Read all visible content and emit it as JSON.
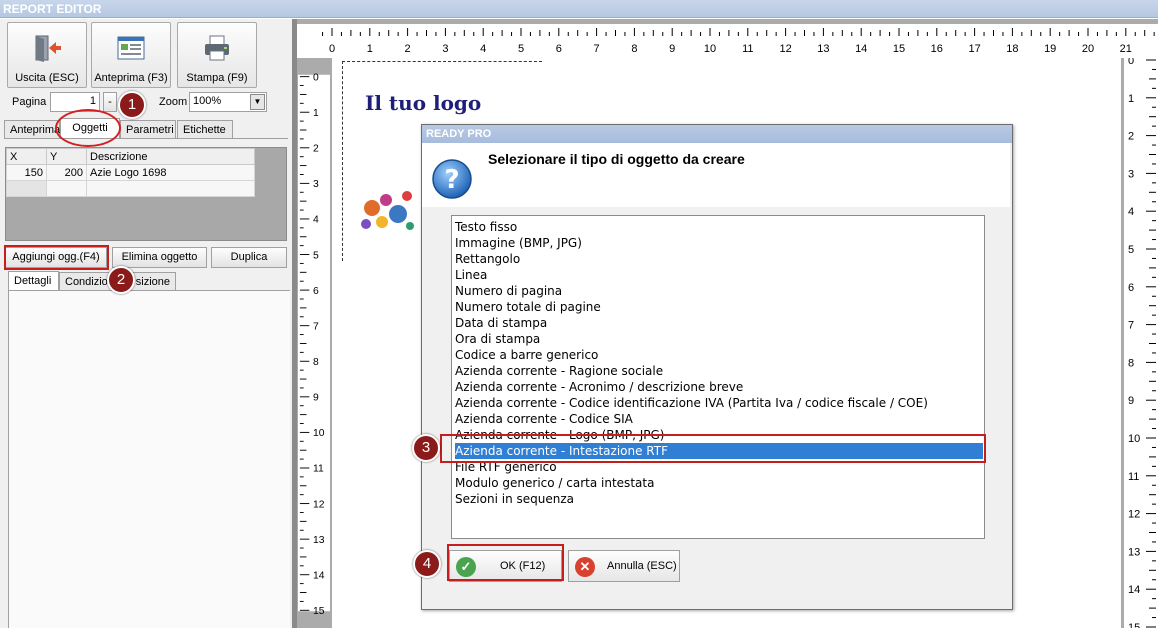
{
  "window": {
    "title": "REPORT EDITOR"
  },
  "toolbar": {
    "exit_label": "Uscita (ESC)",
    "preview_label": "Anteprima (F3)",
    "print_label": "Stampa (F9)"
  },
  "pager": {
    "page_label": "Pagina",
    "page_value": "1",
    "minus_label": "-",
    "zoom_label": "Zoom",
    "zoom_value": "100%"
  },
  "tabs": [
    "Anteprima",
    "Oggetti",
    "Parametri",
    "Etichette"
  ],
  "objects_table": {
    "columns": [
      "X",
      "Y",
      "Descrizione"
    ],
    "rows": [
      {
        "x": "150",
        "y": "200",
        "descrizione": "Azie Logo 1698"
      }
    ]
  },
  "actions": {
    "add_label": "Aggiungi ogg.(F4)",
    "delete_label": "Elimina oggetto",
    "duplicate_label": "Duplica"
  },
  "subtabs": [
    "Dettagli",
    "Condizioni",
    "Posizione"
  ],
  "subtabs_visible": {
    "dettagli": "Dettagli",
    "condizioni": "Condizion",
    "posizione": "sizione"
  },
  "callouts": [
    "1",
    "2",
    "3",
    "4"
  ],
  "ruler": {
    "top": [
      "0",
      "1",
      "2",
      "3",
      "4",
      "5",
      "6",
      "7",
      "8",
      "9",
      "10",
      "11",
      "12",
      "13",
      "14",
      "15",
      "16",
      "17",
      "18",
      "19",
      "20",
      "21"
    ],
    "side": [
      "0",
      "1",
      "2",
      "3",
      "4",
      "5",
      "6",
      "7",
      "8",
      "9",
      "10",
      "11",
      "12",
      "13",
      "14",
      "15"
    ]
  },
  "page": {
    "logo_text": "Il tuo logo"
  },
  "dialog": {
    "title": "READY PRO",
    "message": "Selezionare il tipo di oggetto da creare",
    "items": [
      "Testo fisso",
      "Immagine (BMP, JPG)",
      "Rettangolo",
      "Linea",
      "Numero di pagina",
      "Numero totale di pagine",
      "Data di stampa",
      "Ora di stampa",
      "Codice a barre generico",
      "Azienda corrente - Ragione sociale",
      "Azienda corrente - Acronimo / descrizione breve",
      "Azienda corrente - Codice identificazione IVA (Partita Iva / codice fiscale / COE)",
      "Azienda corrente - Codice SIA",
      "Azienda corrente - Logo (BMP, JPG)",
      "Azienda corrente - Intestazione RTF",
      "File RTF generico",
      "Modulo generico / carta intestata",
      "Sezioni in sequenza"
    ],
    "selected_index": 14,
    "ok_label": "OK (F12)",
    "cancel_label": "Annulla (ESC)"
  },
  "colors": {
    "accent_red": "#c41e1e",
    "selection": "#2f7fd4",
    "badge": "#8b1a1a"
  }
}
